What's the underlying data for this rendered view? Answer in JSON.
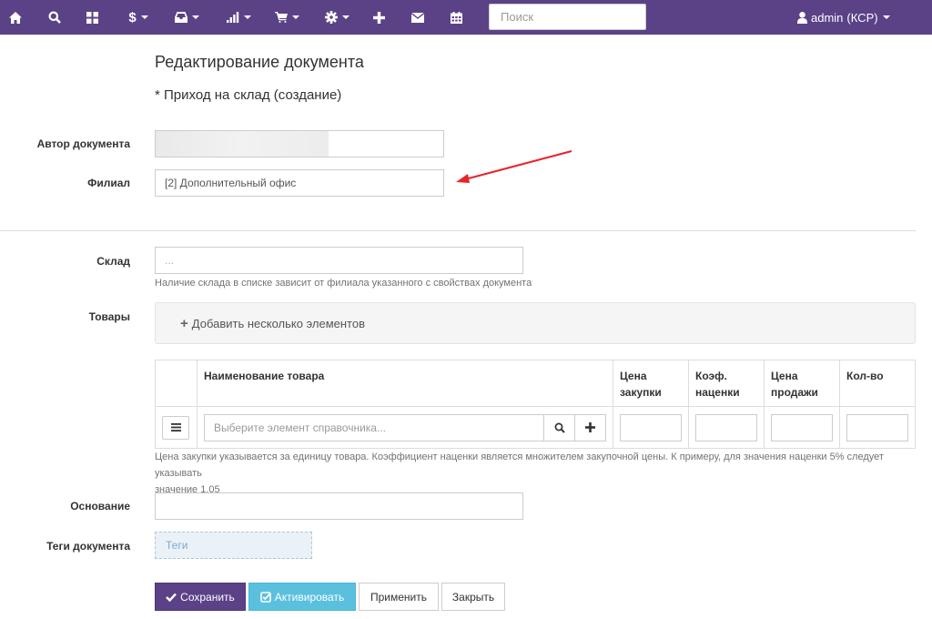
{
  "navbar": {
    "search_placeholder": "Поиск",
    "user_label": "admin",
    "user_suffix": "(КСР)",
    "items": [
      {
        "name": "home-icon"
      },
      {
        "name": "search-icon"
      },
      {
        "name": "dashboard-icon"
      },
      {
        "name": "dollar-icon",
        "text": "$",
        "dropdown": true
      },
      {
        "name": "inbox-icon",
        "dropdown": true
      },
      {
        "name": "stats-icon",
        "dropdown": true
      },
      {
        "name": "cart-icon",
        "dropdown": true
      },
      {
        "name": "gear-icon",
        "dropdown": true
      },
      {
        "name": "plus-icon"
      },
      {
        "name": "envelope-icon"
      },
      {
        "name": "calendar-icon"
      }
    ]
  },
  "page": {
    "title": "Редактирование документа",
    "subtitle": "* Приход на склад (создание)"
  },
  "form": {
    "author_label": "Автор документа",
    "branch_label": "Филиал",
    "branch_value": "[2] Дополнительный офис",
    "warehouse_label": "Склад",
    "warehouse_placeholder": "...",
    "warehouse_hint": "Наличие склада в списке зависит от филиала указанного с свойствах документа",
    "goods_label": "Товары",
    "add_several_label": "Добавить несколько элементов",
    "basis_label": "Основание",
    "tags_label": "Теги документа",
    "tags_placeholder": "Теги",
    "price_hint_line1": "Цена закупки указывается за единицу товара. Коэффициент наценки является множителем закупочной цены. К примеру, для значения наценки 5% следует указывать",
    "price_hint_line2": "значение 1.05"
  },
  "table": {
    "headers": {
      "name": "Наименование товара",
      "purchase_price_1": "Цена",
      "purchase_price_2": "закупки",
      "markup_1": "Коэф.",
      "markup_2": "наценки",
      "sale_price_1": "Цена",
      "sale_price_2": "продажи",
      "qty": "Кол-во"
    },
    "row": {
      "select_placeholder": "Выберите элемент справочника..."
    }
  },
  "buttons": {
    "save": "Сохранить",
    "activate": "Активировать",
    "apply": "Применить",
    "close": "Закрыть"
  },
  "colors": {
    "navbar": "#5b4287",
    "save_button": "#5b4287",
    "activate_button": "#5bc0de",
    "annotation_arrow": "#e8232a"
  }
}
